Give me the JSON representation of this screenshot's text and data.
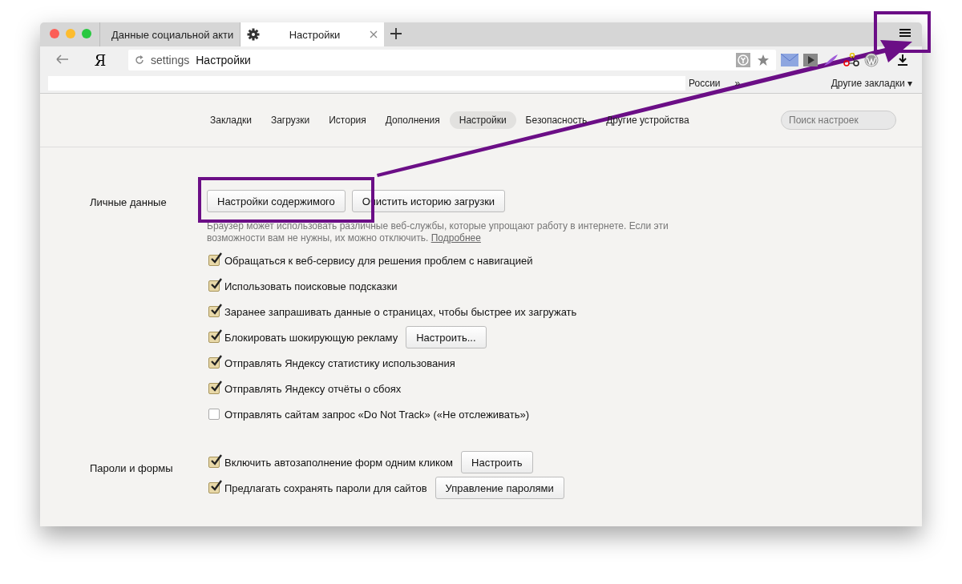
{
  "tabs": [
    {
      "title": "Данные социальной акти",
      "kind": "site",
      "selected": false
    },
    {
      "title": "Настройки",
      "kind": "settings",
      "selected": true
    }
  ],
  "address": {
    "scheme": "settings",
    "title": "Настройки"
  },
  "logo": "Я",
  "bookmarks": {
    "items": [
      "России",
      "»"
    ],
    "other": "Другие закладки ▾"
  },
  "nav": [
    {
      "label": "Закладки",
      "selected": false
    },
    {
      "label": "Загрузки",
      "selected": false
    },
    {
      "label": "История",
      "selected": false
    },
    {
      "label": "Дополнения",
      "selected": false
    },
    {
      "label": "Настройки",
      "selected": true
    },
    {
      "label": "Безопасность",
      "selected": false
    },
    {
      "label": "Другие устройства",
      "selected": false
    }
  ],
  "search": {
    "placeholder": "Поиск настроек"
  },
  "sections": [
    {
      "title": "Личные данные",
      "buttons": [
        "Настройки содержимого",
        "Очистить историю загрузки"
      ],
      "description": "Браузер может использовать различные веб-службы, которые упрощают работу в интернете. Если эти возможности вам не нужны, их можно отключить.",
      "link": "Подробнее",
      "options": [
        {
          "label": "Обращаться к веб-сервису для решения проблем с навигацией",
          "checked": true
        },
        {
          "label": "Использовать поисковые подсказки",
          "checked": true
        },
        {
          "label": "Заранее запрашивать данные о страницах, чтобы быстрее их загружать",
          "checked": true
        },
        {
          "label": "Блокировать шокирующую рекламу",
          "checked": true,
          "button": "Настроить..."
        },
        {
          "label": "Отправлять Яндексу статистику использования",
          "checked": true
        },
        {
          "label": "Отправлять Яндексу отчёты о сбоях",
          "checked": true
        },
        {
          "label": "Отправлять сайтам запрос «Do Not Track» («Не отслеживать»)",
          "checked": false
        }
      ]
    },
    {
      "title": "Пароли и формы",
      "options": [
        {
          "label": "Включить автозаполнение форм одним кликом",
          "checked": true,
          "button": "Настроить"
        },
        {
          "label": "Предлагать сохранять пароли для сайтов",
          "checked": true,
          "button": "Управление паролями"
        }
      ]
    }
  ]
}
